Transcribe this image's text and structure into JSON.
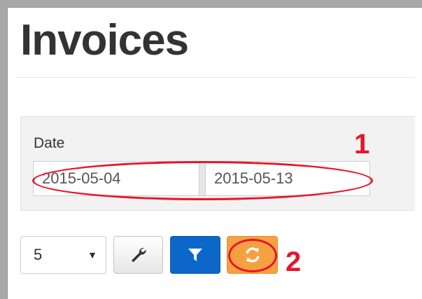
{
  "page": {
    "title": "Invoices"
  },
  "filters": {
    "date_label": "Date",
    "date_from": "2015-05-04",
    "date_to": "2015-05-13"
  },
  "toolbar": {
    "page_size": "5",
    "settings_icon": "wrench-icon",
    "filter_icon": "funnel-icon",
    "refresh_icon": "refresh-icon"
  },
  "annotations": {
    "callout_1": "1",
    "callout_2": "2"
  },
  "colors": {
    "callout": "#e8152b",
    "filter_button": "#0c67c9",
    "refresh_button": "#f5a142"
  }
}
